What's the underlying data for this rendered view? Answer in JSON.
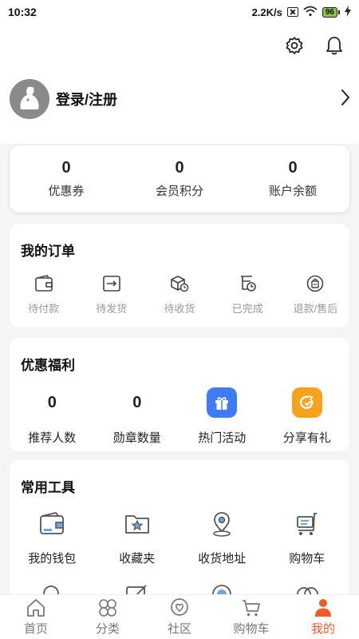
{
  "status_bar": {
    "time": "10:32",
    "speed": "2.2K/s",
    "battery": "96"
  },
  "colors": {
    "accent": "#f05a28",
    "hot_activity": "#3d7bf7",
    "share_gift": "#f7a21b"
  },
  "profile": {
    "login_label": "登录/注册"
  },
  "stats": [
    {
      "value": "0",
      "label": "优惠券"
    },
    {
      "value": "0",
      "label": "会员积分"
    },
    {
      "value": "0",
      "label": "账户余额"
    }
  ],
  "orders": {
    "title": "我的订单",
    "items": [
      {
        "label": "待付款",
        "icon": "wallet-icon"
      },
      {
        "label": "待发货",
        "icon": "export-box-icon"
      },
      {
        "label": "待收货",
        "icon": "package-clock-icon"
      },
      {
        "label": "已完成",
        "icon": "done-clock-icon"
      },
      {
        "label": "退款/售后",
        "icon": "refund-bag-icon"
      }
    ]
  },
  "welfare": {
    "title": "优惠福利",
    "items": [
      {
        "value": "0",
        "label": "推荐人数"
      },
      {
        "value": "0",
        "label": "勋章数量"
      },
      {
        "label": "热门活动",
        "icon": "gift-icon"
      },
      {
        "label": "分享有礼",
        "icon": "share-icon"
      }
    ]
  },
  "tools": {
    "title": "常用工具",
    "items": [
      {
        "label": "我的钱包",
        "icon": "wallet-icon"
      },
      {
        "label": "收藏夹",
        "icon": "favorites-folder-icon"
      },
      {
        "label": "收货地址",
        "icon": "location-pin-icon"
      },
      {
        "label": "购物车",
        "icon": "shopping-cart-icon"
      }
    ]
  },
  "tabbar": {
    "items": [
      {
        "label": "首页",
        "icon": "home-icon",
        "active": false
      },
      {
        "label": "分类",
        "icon": "category-icon",
        "active": false
      },
      {
        "label": "社区",
        "icon": "community-icon",
        "active": false
      },
      {
        "label": "购物车",
        "icon": "cart-icon",
        "active": false
      },
      {
        "label": "我的",
        "icon": "profile-icon",
        "active": true
      }
    ]
  }
}
